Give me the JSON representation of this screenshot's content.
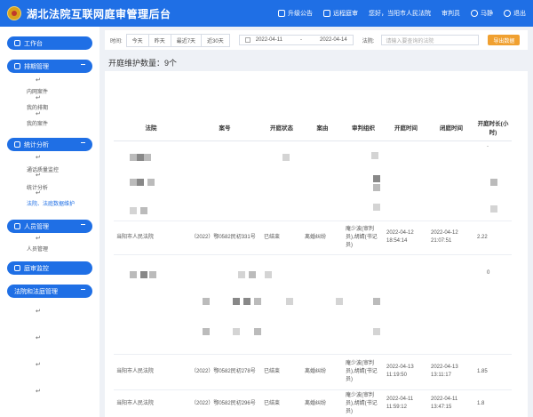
{
  "header": {
    "title": "湖北法院互联网庭审管理后台",
    "nav": [
      {
        "label": "升级公告",
        "icon": "announcement-icon"
      },
      {
        "label": "远程庭审",
        "icon": "remote-trial-icon"
      },
      {
        "label": "您好，当阳市人民法院",
        "icon": ""
      },
      {
        "label": "审判员",
        "icon": ""
      },
      {
        "label": "马静",
        "icon": "user-icon"
      },
      {
        "label": "退出",
        "icon": "logout-icon"
      }
    ]
  },
  "sidebar": {
    "menus": [
      {
        "label": "工作台",
        "icon": "dashboard-icon"
      },
      {
        "label": "排期管理",
        "icon": "schedule-icon"
      },
      {
        "label": "统计分析",
        "icon": "chart-icon"
      },
      {
        "label": "人员管理",
        "icon": "people-icon"
      },
      {
        "label": "庭审监控",
        "icon": "monitor-icon"
      },
      {
        "label": "法院和法庭管理",
        "icon": ""
      }
    ],
    "schedule_sub": [
      "内网案件",
      "我的排期",
      "我的案件"
    ],
    "stats_sub": [
      "通话质量监控",
      "统计分析",
      "法院、法庭数据维护"
    ],
    "people_sub": [
      "人员管理"
    ]
  },
  "filter": {
    "time_label": "时间:",
    "quick": [
      "今天",
      "昨天",
      "最近7天",
      "近30天"
    ],
    "start_date": "2022-04-11",
    "end_date": "2022-04-14",
    "court_label": "法院:",
    "court_placeholder": "请输入要查询的法院",
    "export_label": "导出数据"
  },
  "count_text": "开庭维护数量：9个",
  "table": {
    "headers": [
      "法院",
      "案号",
      "开庭状态",
      "案由",
      "审判组织",
      "开庭时间",
      "闭庭时间",
      "开庭时长(小时)"
    ],
    "rows": [
      {
        "court": "当阳市人民法院",
        "case_no": "（2022）鄂0582民初331号",
        "status": "已结束",
        "cause": "离婚纠纷",
        "org": "庵少波(审判员),胡婧(书记员)",
        "open": "2022-04-12 18:54:14",
        "close": "2022-04-12 21:07:51",
        "hours": "2.22"
      },
      {
        "court": "当阳市人民法院",
        "case_no": "（2022）鄂0582民初278号",
        "status": "已结束",
        "cause": "离婚纠纷",
        "org": "庵少波(审判员),胡婧(书记员)",
        "open": "2022-04-13 11:19:50",
        "close": "2022-04-13 13:11:17",
        "hours": "1.85"
      },
      {
        "court": "当阳市人民法院",
        "case_no": "（2022）鄂0582民初296号",
        "status": "已结束",
        "cause": "离婚纠纷",
        "org": "庵少波(审判员),胡婧(书记员)",
        "open": "2022-04-11 11:59:12",
        "close": "2022-04-11 13:47:15",
        "hours": "1.8"
      }
    ],
    "misc": [
      "0",
      "-"
    ]
  },
  "return_glyph": "↵",
  "colors": {
    "primary": "#1f6fe5",
    "export": "#f0a030"
  }
}
